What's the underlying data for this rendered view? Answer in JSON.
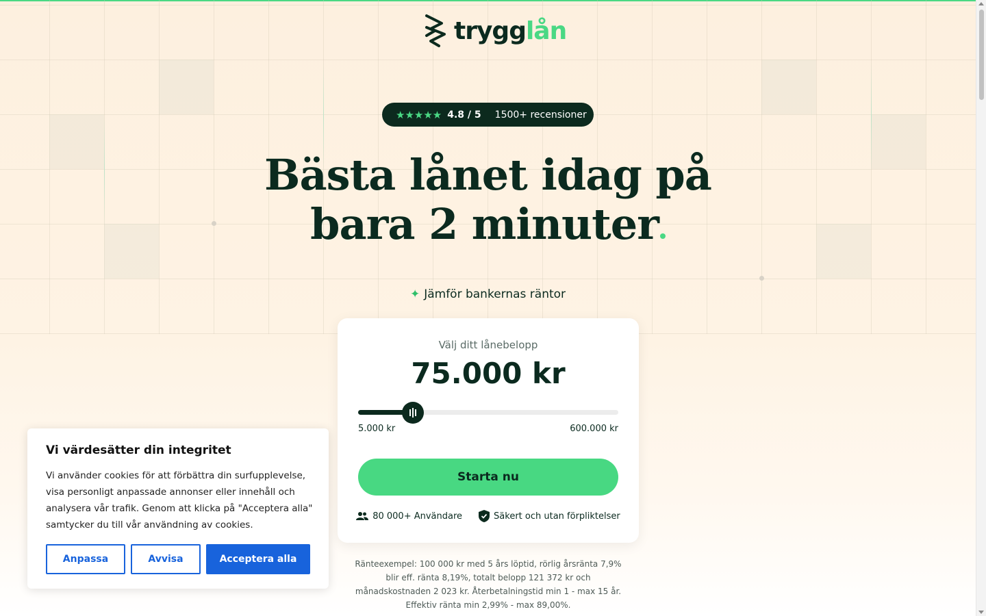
{
  "brand": {
    "name_part1": "trygg",
    "name_part2": "lån",
    "accent_color": "#4ad884",
    "dark_color": "#0c2a1e"
  },
  "rating": {
    "stars": "★★★★★",
    "score": "4.8 / 5",
    "count": "1500+ recensioner",
    "value": 4.8,
    "max": 5
  },
  "hero": {
    "headline_line1": "Bästa lånet idag på",
    "headline_line2": "bara 2 minuter",
    "subtitle": "Jämför bankernas räntor"
  },
  "calculator": {
    "label": "Välj ditt lånebelopp",
    "amount": "75.000 kr",
    "amount_value": 75000,
    "min_label": "5.000 kr",
    "max_label": "600.000 kr",
    "min_value": 5000,
    "max_value": 600000,
    "cta_label": "Starta nu",
    "trust_users": "80 000+ Användare",
    "trust_safe": "Säkert och utan förpliktelser"
  },
  "disclaimer": "Ränteexempel: 100 000 kr med 5 års löptid, rörlig årsränta 7,9% blir eff. ränta 8,19%, totalt belopp 121 372 kr och månadskostnaden 2 023 kr. Återbetalningstid min 1 - max 15 år. Effektiv ränta min 2,99% - max 89,00%.",
  "cookie_banner": {
    "title": "Vi värdesätter din integritet",
    "text": "Vi använder cookies för att förbättra din surfupplevelse, visa personligt anpassade annonser eller innehåll och analysera vår trafik. Genom att klicka på \"Acceptera alla\" samtycker du till vår användning av cookies.",
    "customize_label": "Anpassa",
    "reject_label": "Avvisa",
    "accept_label": "Acceptera alla",
    "button_color": "#1863dc"
  }
}
